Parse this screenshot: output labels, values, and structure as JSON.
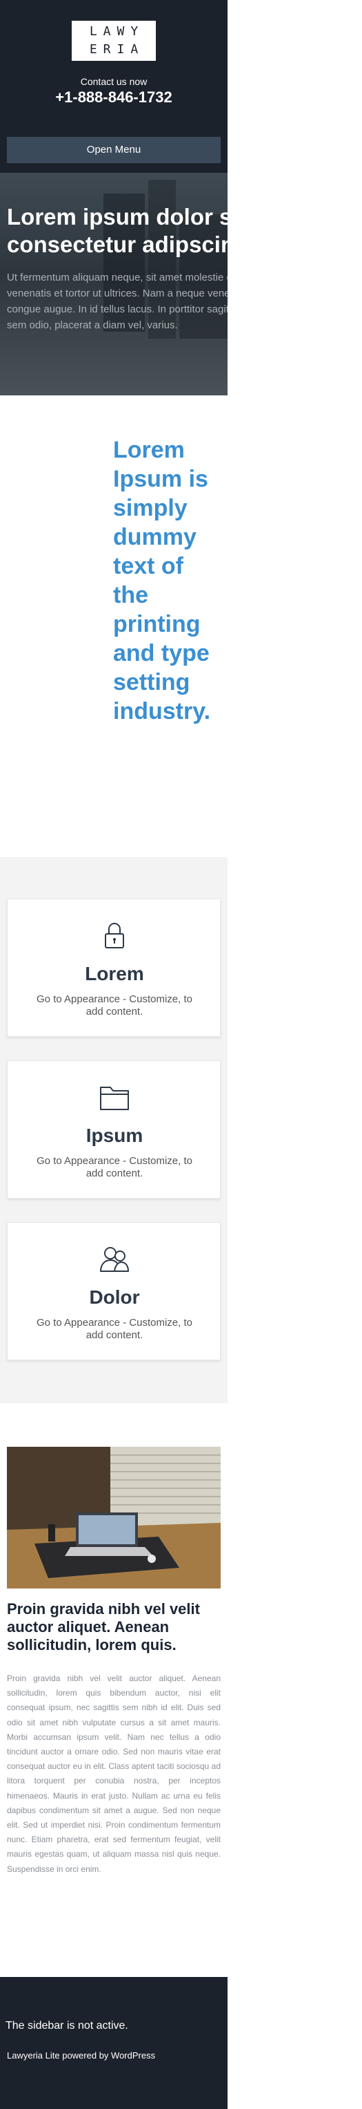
{
  "header": {
    "logo_line1": "LAWY",
    "logo_line2": "ERIA",
    "contact_label": "Contact us now",
    "phone": "+1-888-846-1732",
    "menu_button": "Open Menu"
  },
  "hero": {
    "title": "Lorem ipsum dolor sit amet, consectetur adipscing elit.",
    "text": "Ut fermentum aliquam neque, sit amet molestie orci porttitor sit amet. Mauris venenatis et tortor ut ultrices. Nam a neque venenatis, tristique lacus id, congue augue. In id tellus lacus. In porttitor sagittis tellus nec iaculis. Nunc sem odio, placerat a diam vel, varius."
  },
  "intro": {
    "heading": "Lorem Ipsum is simply dummy text of the printing and type setting industry."
  },
  "features": [
    {
      "icon": "lock-icon",
      "title": "Lorem",
      "text": "Go to Appearance - Customize, to add content."
    },
    {
      "icon": "folder-icon",
      "title": "Ipsum",
      "text": "Go to Appearance - Customize, to add content."
    },
    {
      "icon": "users-icon",
      "title": "Dolor",
      "text": "Go to Appearance - Customize, to add content."
    }
  ],
  "post": {
    "title": "Proin gravida nibh vel velit auctor aliquet. Aenean sollicitudin, lorem quis.",
    "text": "Proin gravida nibh vel velit auctor aliquet. Aenean sollicitudin, lorem quis bibendum auctor, nisi elit consequat ipsum, nec sagittis sem nibh id elit. Duis sed odio sit amet nibh vulputate cursus a sit amet mauris. Morbi accumsan ipsum velit. Nam nec tellus a odio tincidunt auctor a ornare odio. Sed non mauris vitae erat consequat auctor eu in elit. Class aptent taciti sociosqu ad litora torquent per conubia nostra, per inceptos himenaeos. Mauris in erat justo. Nullam ac urna eu felis dapibus condimentum sit amet a augue. Sed non neque elit. Sed ut imperdiet nisi. Proin condimentum fermentum nunc. Etiam pharetra, erat sed fermentum feugiat, velit mauris egestas quam, ut aliquam massa nisl quis neque. Suspendisse in orci enim."
  },
  "footer": {
    "sidebar_note": "The sidebar is not active.",
    "powered_by": "Lawyeria Lite powered by WordPress"
  },
  "colors": {
    "header_bg": "#1c222b",
    "accent_blue": "#3a8fd1",
    "menu_button_bg": "#3b4a5a"
  }
}
